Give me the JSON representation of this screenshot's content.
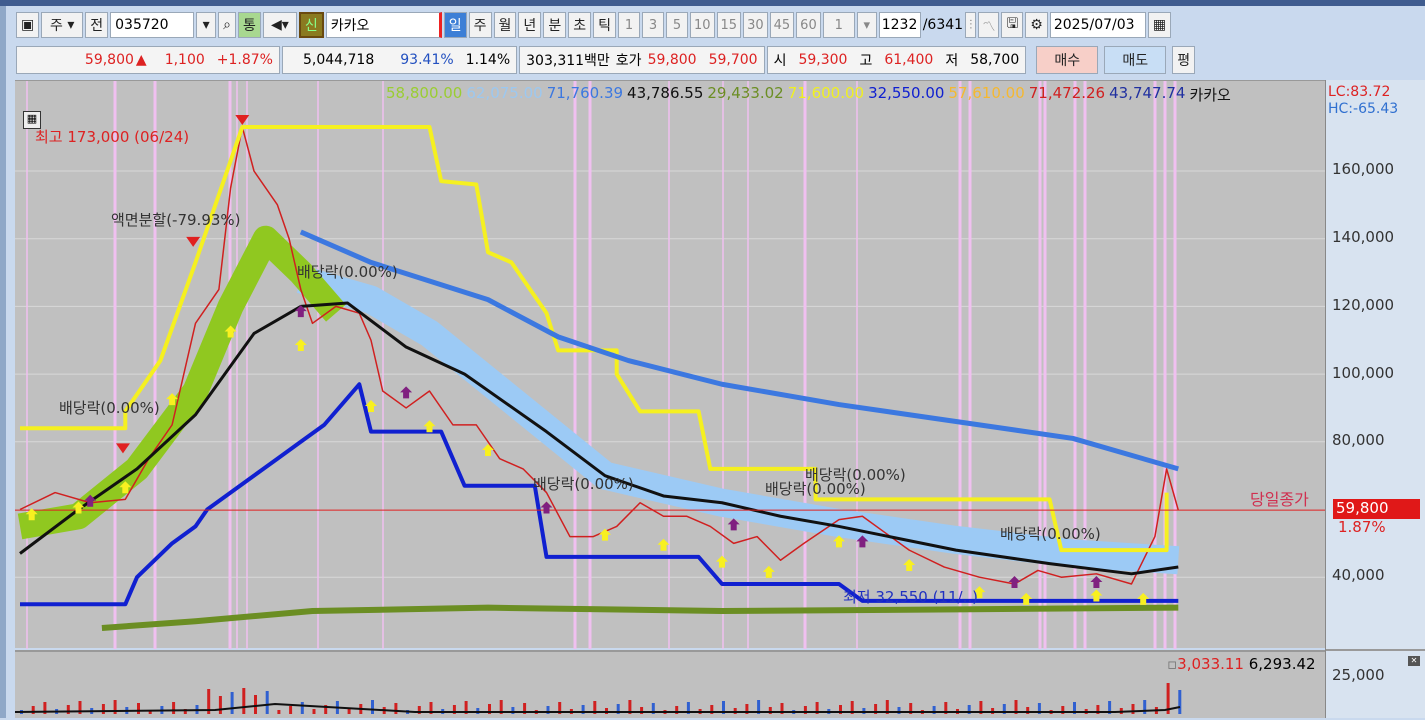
{
  "toolbar": {
    "layout_btn": "▣",
    "market": "주",
    "prev": "전",
    "code": "035720",
    "search_icon": "search",
    "volume_btn": "통",
    "speaker": "🔈",
    "credit": "신",
    "name": "카카오",
    "periods": [
      "일",
      "주",
      "월",
      "년",
      "분",
      "초",
      "틱"
    ],
    "minutes": [
      "1",
      "3",
      "5",
      "10",
      "15",
      "30",
      "45",
      "60"
    ],
    "multiplier": "1",
    "count": "1232",
    "total": "/6341",
    "date": "2025/07/03"
  },
  "quote": {
    "price": "59,800",
    "arrow": "▲",
    "change": "1,100",
    "pct": "+1.87%",
    "volume": "5,044,718",
    "vol_ratio": "93.41%",
    "turnover": "1.14%",
    "amount": "303,311백만",
    "hoga_label": "호가",
    "ask": "59,800",
    "bid": "59,700",
    "open_label": "시",
    "open": "59,300",
    "high_label": "고",
    "high": "61,400",
    "low_label": "저",
    "low": "58,700",
    "buy": "매수",
    "sell": "매도",
    "eval": "평"
  },
  "legend": [
    {
      "text": "58,800.00",
      "color": "#9acd32"
    },
    {
      "text": "62,075.00",
      "color": "#9cc8f0"
    },
    {
      "text": "71,760.39",
      "color": "#3c78e0"
    },
    {
      "text": "43,786.55",
      "color": "#111111"
    },
    {
      "text": "29,433.02",
      "color": "#6b8e23"
    },
    {
      "text": "71,600.00",
      "color": "#f0f020"
    },
    {
      "text": "32,550.00",
      "color": "#1020d0"
    },
    {
      "text": "57,610.00",
      "color": "#f5b830"
    },
    {
      "text": "71,472.26",
      "color": "#d02020"
    },
    {
      "text": "43,747.74",
      "color": "#2030a0"
    },
    {
      "text": "카카오",
      "color": "#111111"
    }
  ],
  "lc": "LC:83.72",
  "hc": "HC:-65.43",
  "annotations": {
    "high": "최고 173,000 (06/24)",
    "split": "액면분할(-79.93%)",
    "div1": "배당락(0.00%)",
    "div2": "배당락(0.00%)",
    "div3": "배당락(0.00%)",
    "div4": "배당락(0.00%)",
    "div5": "배당락(0.00%)",
    "div6": "배당락(0.00%)",
    "low": "최저 32,550 (11/..)",
    "close_label": "당일종가"
  },
  "axis": {
    "ticks": [
      "160,000",
      "140,000",
      "120,000",
      "100,000",
      "80,000",
      "40,000"
    ],
    "current": "59,800",
    "current_pct": "1.87%",
    "vol_tick": "25,000"
  },
  "volume_legend": [
    "3,033.11",
    "6,293.42"
  ],
  "chart": {
    "type": "line",
    "x_range": [
      0,
      100
    ],
    "y_range": [
      22000,
      178000
    ],
    "close": 59800,
    "tick_values": [
      160000,
      140000,
      120000,
      100000,
      80000,
      40000
    ],
    "series": [
      {
        "name": "price",
        "color": "#d02020",
        "points": [
          [
            0,
            60000
          ],
          [
            3,
            65000
          ],
          [
            6,
            62000
          ],
          [
            9,
            63000
          ],
          [
            11,
            75000
          ],
          [
            13,
            85000
          ],
          [
            15,
            115000
          ],
          [
            17,
            125000
          ],
          [
            18,
            155000
          ],
          [
            19,
            173000
          ],
          [
            20,
            160000
          ],
          [
            22,
            150000
          ],
          [
            23,
            140000
          ],
          [
            24,
            125000
          ],
          [
            25,
            115000
          ],
          [
            27,
            120000
          ],
          [
            29,
            118000
          ],
          [
            30,
            110000
          ],
          [
            31,
            95000
          ],
          [
            33,
            90000
          ],
          [
            35,
            95000
          ],
          [
            37,
            85000
          ],
          [
            39,
            85000
          ],
          [
            41,
            75000
          ],
          [
            43,
            72000
          ],
          [
            45,
            65000
          ],
          [
            47,
            52000
          ],
          [
            49,
            52000
          ],
          [
            51,
            55000
          ],
          [
            53,
            62000
          ],
          [
            55,
            58000
          ],
          [
            57,
            58000
          ],
          [
            59,
            55000
          ],
          [
            61,
            50000
          ],
          [
            63,
            52000
          ],
          [
            65,
            45000
          ],
          [
            67,
            50000
          ],
          [
            70,
            57000
          ],
          [
            72,
            58000
          ],
          [
            74,
            53000
          ],
          [
            76,
            48000
          ],
          [
            79,
            43000
          ],
          [
            82,
            40000
          ],
          [
            85,
            38000
          ],
          [
            87,
            42000
          ],
          [
            89,
            40000
          ],
          [
            92,
            41000
          ],
          [
            95,
            38000
          ],
          [
            97,
            52000
          ],
          [
            98,
            72000
          ],
          [
            99,
            59800
          ]
        ]
      },
      {
        "name": "high52",
        "color": "#f5f020",
        "points": [
          [
            0,
            84000
          ],
          [
            9,
            84000
          ],
          [
            9,
            89000
          ],
          [
            12,
            104000
          ],
          [
            15,
            133000
          ],
          [
            19,
            173000
          ],
          [
            35,
            173000
          ],
          [
            36,
            157000
          ],
          [
            39,
            156000
          ],
          [
            40,
            136000
          ],
          [
            42,
            133000
          ],
          [
            45,
            118000
          ],
          [
            46,
            107000
          ],
          [
            51,
            107000
          ],
          [
            51,
            100000
          ],
          [
            53,
            89000
          ],
          [
            58,
            89000
          ],
          [
            59,
            72000
          ],
          [
            68,
            72000
          ],
          [
            68,
            63000
          ],
          [
            88,
            63000
          ],
          [
            89,
            48000
          ],
          [
            98,
            48000
          ],
          [
            98,
            65000
          ]
        ]
      },
      {
        "name": "low52",
        "color": "#1020d0",
        "points": [
          [
            0,
            32000
          ],
          [
            9,
            32000
          ],
          [
            10,
            40000
          ],
          [
            13,
            50000
          ],
          [
            15,
            55000
          ],
          [
            16,
            60000
          ],
          [
            20,
            70000
          ],
          [
            22,
            75000
          ],
          [
            24,
            80000
          ],
          [
            26,
            85000
          ],
          [
            29,
            97000
          ],
          [
            30,
            83000
          ],
          [
            36,
            83000
          ],
          [
            38,
            67000
          ],
          [
            44,
            67000
          ],
          [
            45,
            46000
          ],
          [
            58,
            46000
          ],
          [
            60,
            38000
          ],
          [
            70,
            38000
          ],
          [
            72,
            33000
          ],
          [
            99,
            33000
          ]
        ]
      },
      {
        "name": "ma_long",
        "color": "#3c78e0",
        "points": [
          [
            24,
            142000
          ],
          [
            30,
            133000
          ],
          [
            40,
            122000
          ],
          [
            46,
            111000
          ],
          [
            52,
            104000
          ],
          [
            60,
            97000
          ],
          [
            70,
            91000
          ],
          [
            80,
            86000
          ],
          [
            90,
            81000
          ],
          [
            99,
            72000
          ]
        ]
      },
      {
        "name": "ma_mid",
        "color": "#111111",
        "points": [
          [
            0,
            47000
          ],
          [
            5,
            60000
          ],
          [
            10,
            72000
          ],
          [
            15,
            88000
          ],
          [
            20,
            112000
          ],
          [
            24,
            120000
          ],
          [
            28,
            121000
          ],
          [
            33,
            108000
          ],
          [
            38,
            100000
          ],
          [
            45,
            83000
          ],
          [
            50,
            70000
          ],
          [
            55,
            64000
          ],
          [
            60,
            62000
          ],
          [
            65,
            58000
          ],
          [
            70,
            55000
          ],
          [
            80,
            48000
          ],
          [
            88,
            44000
          ],
          [
            95,
            41000
          ],
          [
            99,
            43000
          ]
        ]
      },
      {
        "name": "ma_very_long",
        "color": "#6b8e23",
        "points": [
          [
            7,
            25000
          ],
          [
            15,
            27000
          ],
          [
            25,
            30000
          ],
          [
            40,
            31000
          ],
          [
            60,
            30000
          ],
          [
            80,
            30500
          ],
          [
            99,
            31000
          ]
        ]
      }
    ]
  }
}
